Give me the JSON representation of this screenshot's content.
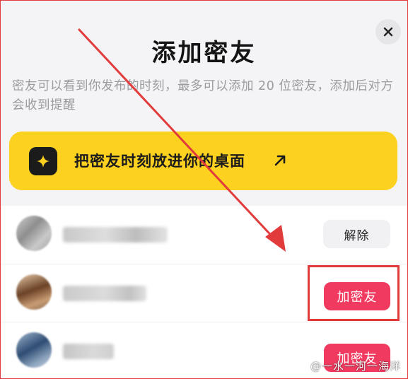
{
  "dialog": {
    "title": "添加密友",
    "description": "密友可以看到你发布的时刻，最多可以添加 20 位密友，添加后对方会收到提醒"
  },
  "banner": {
    "text": "把密友时刻放进你的桌面",
    "icon": "sparkle-icon",
    "arrow_icon": "arrow-up-right-icon",
    "color": "#fcd11f"
  },
  "friends": [
    {
      "action_label": "解除",
      "action_type": "remove"
    },
    {
      "action_label": "加密友",
      "action_type": "add"
    },
    {
      "action_label": "加密友",
      "action_type": "add"
    }
  ],
  "watermark": {
    "text": "@一水一河一海洋"
  },
  "colors": {
    "accent": "#f03a5f",
    "annotation": "#e23b3b"
  }
}
